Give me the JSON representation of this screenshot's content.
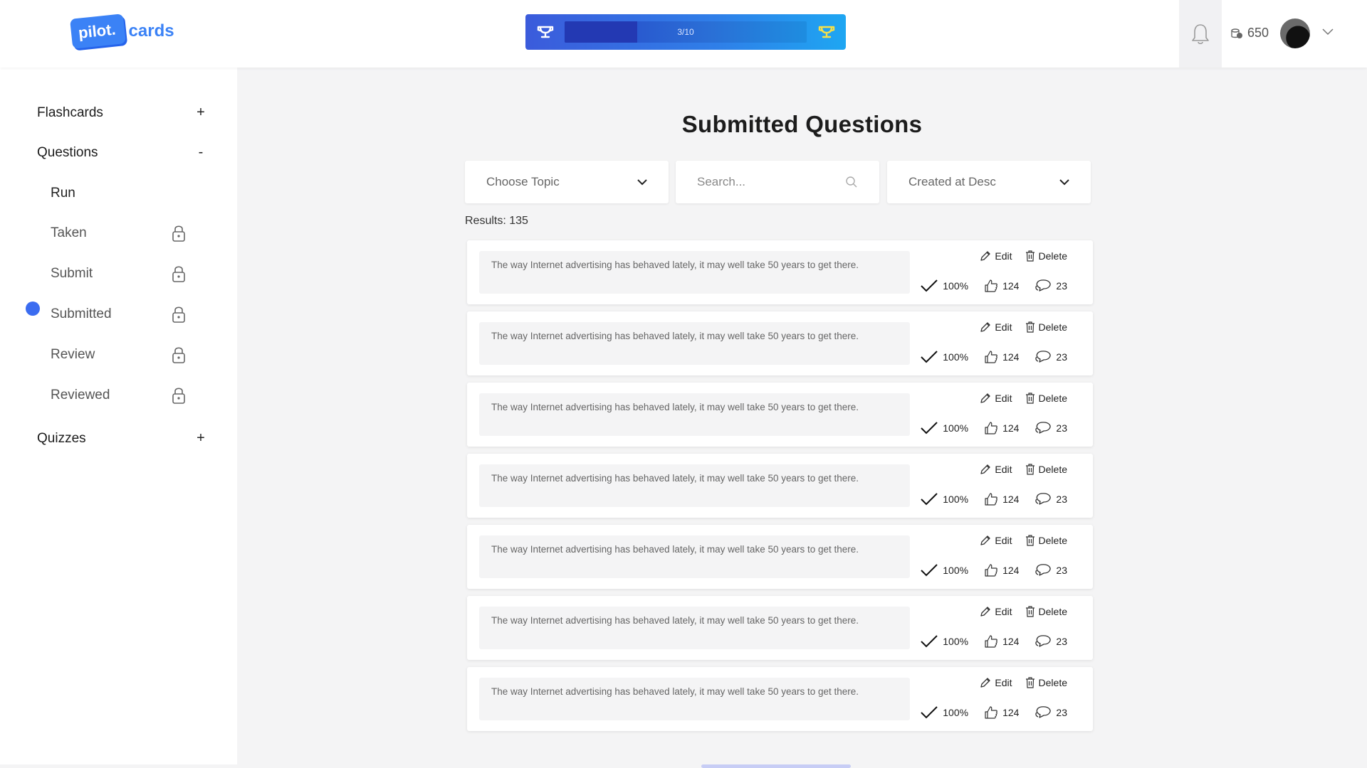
{
  "header": {
    "logo_left": "pilot.",
    "logo_right": "cards",
    "progress_label": "3/10",
    "progress_value": 0.3,
    "coins": "650"
  },
  "sidebar": {
    "flashcards": {
      "label": "Flashcards",
      "toggle": "+"
    },
    "questions": {
      "label": "Questions",
      "toggle": "-"
    },
    "question_items": [
      {
        "label": "Run"
      },
      {
        "label": "Taken"
      },
      {
        "label": "Submit"
      },
      {
        "label": "Submitted"
      },
      {
        "label": "Review"
      },
      {
        "label": "Reviewed"
      }
    ],
    "quizzes": {
      "label": "Quizzes",
      "toggle": "+"
    }
  },
  "main": {
    "title": "Submitted Questions",
    "filters": {
      "topic": "Choose Topic",
      "search_placeholder": "Search...",
      "sort": "Created at Desc"
    },
    "results": "Results: 135",
    "cards": [
      {
        "text": "The way Internet advertising has behaved lately, it may well take 50 years to get there.",
        "edit": "Edit",
        "delete": "Delete",
        "score": "100%",
        "likes": "124",
        "comments": "23"
      },
      {
        "text": "The way Internet advertising has behaved lately, it may well take 50 years to get there.",
        "edit": "Edit",
        "delete": "Delete",
        "score": "100%",
        "likes": "124",
        "comments": "23"
      },
      {
        "text": "The way Internet advertising has behaved lately, it may well take 50 years to get there.",
        "edit": "Edit",
        "delete": "Delete",
        "score": "100%",
        "likes": "124",
        "comments": "23"
      },
      {
        "text": "The way Internet advertising has behaved lately, it may well take 50 years to get there.",
        "edit": "Edit",
        "delete": "Delete",
        "score": "100%",
        "likes": "124",
        "comments": "23"
      },
      {
        "text": "The way Internet advertising has behaved lately, it may well take 50 years to get there.",
        "edit": "Edit",
        "delete": "Delete",
        "score": "100%",
        "likes": "124",
        "comments": "23"
      },
      {
        "text": "The way Internet advertising has behaved lately, it may well take 50 years to get there.",
        "edit": "Edit",
        "delete": "Delete",
        "score": "100%",
        "likes": "124",
        "comments": "23"
      },
      {
        "text": "The way Internet advertising has behaved lately, it may well take 50 years to get there.",
        "edit": "Edit",
        "delete": "Delete",
        "score": "100%",
        "likes": "124",
        "comments": "23"
      }
    ]
  },
  "colors": {
    "accent": "#3b82f6",
    "active_dot": "#3b6cf0",
    "progress_start": "#3b5bdb",
    "progress_end": "#1ea6f2",
    "trophy_yellow": "#f5e04a"
  },
  "icons": {
    "bell": "bell-icon",
    "coin": "coins-icon",
    "lock": "lock-icon",
    "edit": "pencil-icon",
    "delete": "trash-icon",
    "check": "check-icon",
    "like": "thumbs-up-icon",
    "comment": "comment-icon"
  }
}
